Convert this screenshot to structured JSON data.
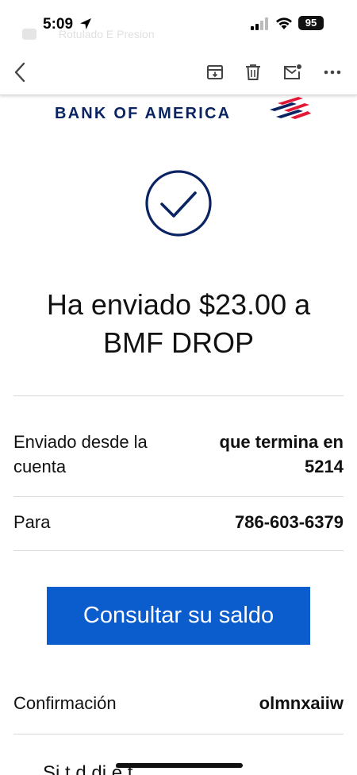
{
  "status_bar": {
    "time": "5:09",
    "battery": "95",
    "ghost_text": "Rotulado  E Presion"
  },
  "toolbar": {
    "back_icon": "chevron-left-icon",
    "archive_icon": "archive-icon",
    "delete_icon": "trash-icon",
    "unread_icon": "mark-unread-icon",
    "more_icon": "more-horizontal-icon"
  },
  "brand": {
    "name": "BANK OF AMERICA",
    "navy": "#0a2463",
    "red": "#e31837"
  },
  "confirmation": {
    "icon": "check-circle-icon",
    "headline_line1": "Ha enviado $23.00 a",
    "headline_line2": "BMF DROP"
  },
  "details": {
    "from_label_line1": "Enviado desde la",
    "from_label_line2": "cuenta",
    "from_value_line1": "que termina en",
    "from_value_line2": "5214",
    "to_label": "Para",
    "to_value": "786-603-6379"
  },
  "cta": {
    "label": "Consultar su saldo",
    "color": "#0b5ccc"
  },
  "confirmation_code": {
    "label": "Confirmación",
    "value": "olmnxaiiw"
  },
  "footer": {
    "partial_text": "Si    t    d            di   é      t"
  }
}
